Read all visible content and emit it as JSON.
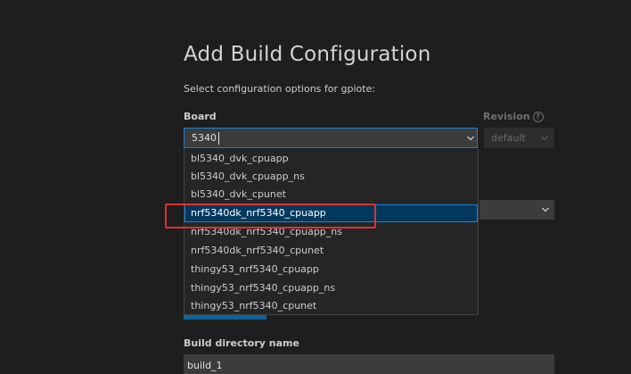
{
  "page": {
    "title": "Add Build Configuration",
    "subtitle": "Select configuration options for gpiote:"
  },
  "board": {
    "label": "Board",
    "value": "5340",
    "options": [
      "bl5340_dvk_cpuapp",
      "bl5340_dvk_cpuapp_ns",
      "bl5340_dvk_cpunet",
      "nrf5340dk_nrf5340_cpuapp",
      "nrf5340dk_nrf5340_cpuapp_ns",
      "nrf5340dk_nrf5340_cpunet",
      "thingy53_nrf5340_cpuapp",
      "thingy53_nrf5340_cpuapp_ns",
      "thingy53_nrf5340_cpunet"
    ],
    "selected_index": 3
  },
  "revision": {
    "label": "Revision",
    "help_icon": "question-circle-icon",
    "placeholder": "default"
  },
  "build_directory": {
    "label": "Build directory name",
    "value": "build_1"
  },
  "colors": {
    "background": "#1e1e1e",
    "focus_border": "#1b80d8",
    "selected_item": "#04395e",
    "annotation_box": "#e0312e",
    "primary_button": "#0e639c"
  }
}
